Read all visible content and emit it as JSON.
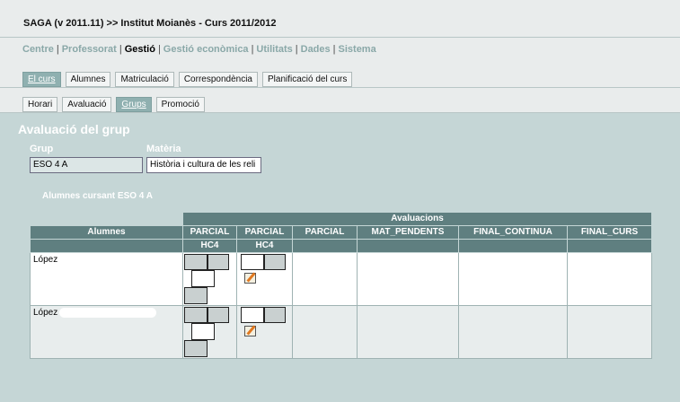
{
  "window": {
    "title": "SAGA (v 2011.11) >> Institut Moianès - Curs 2011/2012"
  },
  "main_menu": [
    {
      "label": "Centre",
      "active": false
    },
    {
      "label": "Professorat",
      "active": false
    },
    {
      "label": "Gestió",
      "active": true
    },
    {
      "label": "Gestió econòmica",
      "active": false
    },
    {
      "label": "Utilitats",
      "active": false
    },
    {
      "label": "Dades",
      "active": false
    },
    {
      "label": "Sistema",
      "active": false
    }
  ],
  "tabs_level1": [
    {
      "label": "El curs",
      "active": true
    },
    {
      "label": "Alumnes",
      "active": false
    },
    {
      "label": "Matriculació",
      "active": false
    },
    {
      "label": "Correspondència",
      "active": false
    },
    {
      "label": "Planificació del curs",
      "active": false
    }
  ],
  "tabs_level2": [
    {
      "label": "Horari",
      "active": false
    },
    {
      "label": "Avaluació",
      "active": false
    },
    {
      "label": "Grups",
      "active": true
    },
    {
      "label": "Promoció",
      "active": false
    }
  ],
  "section": {
    "title": "Avaluació del grup"
  },
  "filters": {
    "grup_label": "Grup",
    "grup_value": "ESO 4 A",
    "materia_label": "Matèria",
    "materia_value": "Història i cultura de les reli"
  },
  "cursant_label": "Alumnes cursant ESO 4 A",
  "table": {
    "group_header": "Avaluacions",
    "col_alumnes": "Alumnes",
    "columns": [
      "PARCIAL",
      "PARCIAL",
      "PARCIAL",
      "MAT_PENDENTS",
      "FINAL_CONTINUA",
      "FINAL_CURS"
    ],
    "subheaders": [
      "HC4",
      "HC4",
      "",
      "",
      "",
      ""
    ],
    "rows": [
      {
        "name": "López"
      },
      {
        "name": "López"
      }
    ]
  },
  "icons": {
    "edit_note": "edit-note-icon"
  }
}
